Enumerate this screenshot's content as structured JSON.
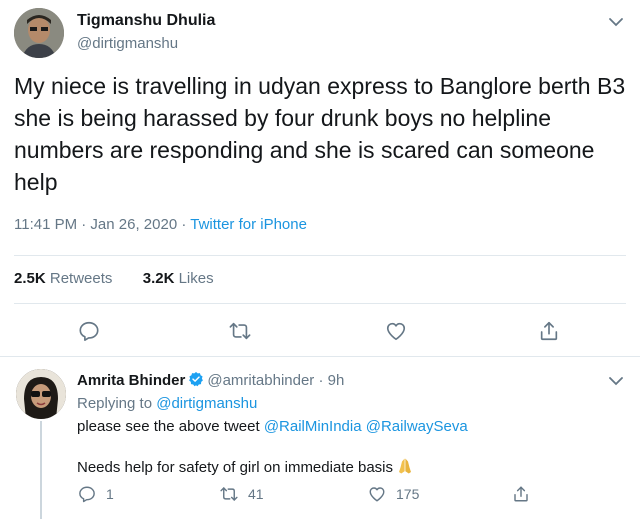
{
  "tweet": {
    "author_name": "Tigmanshu Dhulia",
    "author_handle": "@dirtigmanshu",
    "text": "My niece is travelling in udyan express to Banglore berth B3 she is being harassed by four drunk boys no helpline numbers are responding and she is scared can someone help",
    "time": "11:41 PM · Jan 26, 2020 ·",
    "source": "Twitter for iPhone",
    "retweets_count": "2.5K",
    "retweets_label": "Retweets",
    "likes_count": "3.2K",
    "likes_label": "Likes",
    "icons": [
      "reply-icon",
      "retweet-icon",
      "like-icon",
      "share-icon",
      "chevron-down-icon"
    ]
  },
  "reply": {
    "author_name": "Amrita Bhinder",
    "author_handle": "@amritabhinder · 9h",
    "replying_prefix": "Replying to",
    "replying_to": "@dirtigmanshu",
    "text1_plain": "please see the above tweet",
    "mention1": "@RailMinIndia",
    "mention2": "@RailwaySeva",
    "text2": "Needs help for safety of girl on immediate basis",
    "reply_count": "1",
    "retweet_count": "41",
    "like_count": "175",
    "icons": [
      "verified-badge-icon",
      "folded-hands-emoji-icon",
      "reply-icon",
      "retweet-icon",
      "like-icon",
      "share-icon",
      "chevron-down-icon"
    ]
  },
  "colors": {
    "text": "#14171a",
    "secondary": "#657786",
    "link": "#1b95e0",
    "divider": "#e1e8ed",
    "verified": "#1da1f2"
  }
}
